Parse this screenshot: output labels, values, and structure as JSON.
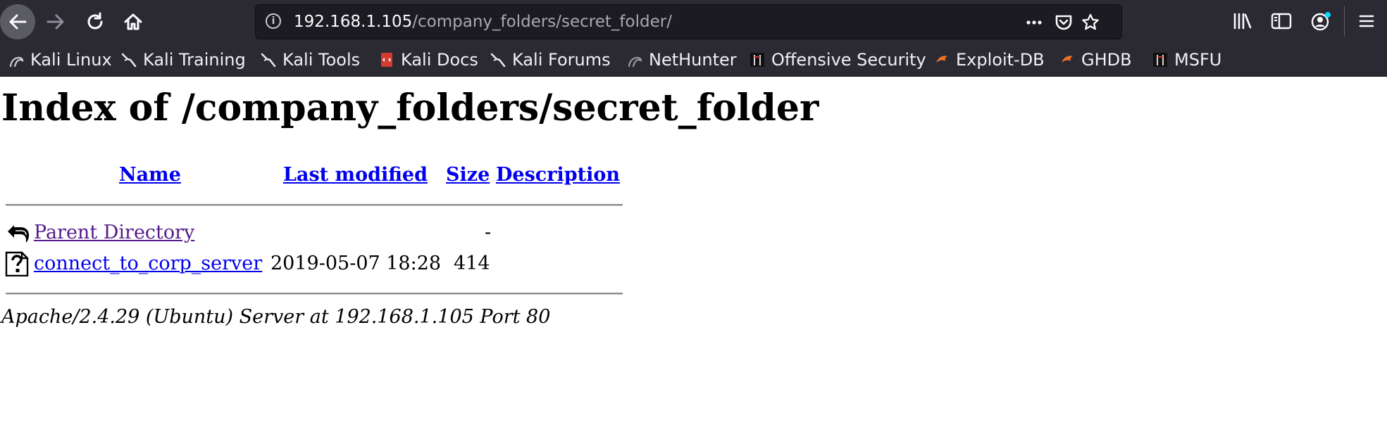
{
  "browser": {
    "url": {
      "host": "192.168.1.105",
      "path": "/company_folders/secret_folder/"
    },
    "bookmarks": [
      {
        "label": "Kali Linux",
        "icon": "kali-dragon-icon"
      },
      {
        "label": "Kali Training",
        "icon": "kali-dragon-icon"
      },
      {
        "label": "Kali Tools",
        "icon": "kali-dragon-icon"
      },
      {
        "label": "Kali Docs",
        "icon": "kali-docs-icon"
      },
      {
        "label": "Kali Forums",
        "icon": "kali-dragon-icon"
      },
      {
        "label": "NetHunter",
        "icon": "nethunter-icon"
      },
      {
        "label": "Offensive Security",
        "icon": "offsec-icon"
      },
      {
        "label": "Exploit-DB",
        "icon": "exploit-db-icon"
      },
      {
        "label": "GHDB",
        "icon": "exploit-db-icon"
      },
      {
        "label": "MSFU",
        "icon": "offsec-icon"
      }
    ]
  },
  "page": {
    "title": "Index of /company_folders/secret_folder",
    "columns": {
      "name": "Name",
      "modified": "Last modified",
      "size": "Size",
      "description": "Description"
    },
    "rows": [
      {
        "icon": "back-arrow-icon",
        "name": "Parent Directory",
        "modified": "",
        "size": "-",
        "description": ""
      },
      {
        "icon": "unknown-file-icon",
        "name": "connect_to_corp_server",
        "modified": "2019-05-07 18:28",
        "size": "414",
        "description": ""
      }
    ],
    "footer": "Apache/2.4.29 (Ubuntu) Server at 192.168.1.105 Port 80"
  },
  "colors": {
    "chrome": "#2b2a33",
    "link": "#0000ee",
    "visited": "#551a8b"
  }
}
